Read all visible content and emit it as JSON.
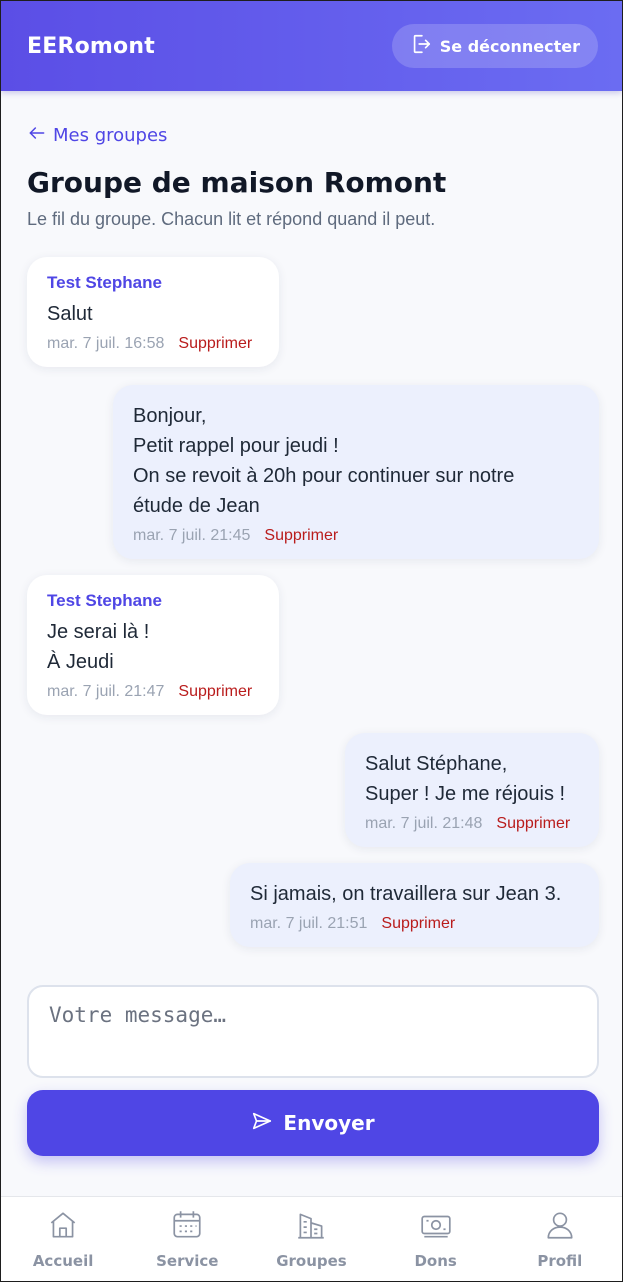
{
  "header": {
    "brand": "EERomont",
    "logout_label": "Se déconnecter"
  },
  "nav_back": {
    "label": "Mes groupes"
  },
  "page": {
    "title": "Groupe de maison Romont",
    "subtitle": "Le fil du groupe. Chacun lit et répond quand il peut."
  },
  "messages": [
    {
      "author": "Test Stephane",
      "text": "Salut",
      "time": "mar. 7 juil. 16:58",
      "delete_label": "Supprimer"
    },
    {
      "author": "",
      "text": "Bonjour,\nPetit rappel pour jeudi !\nOn se revoit à 20h pour continuer sur notre\nétude de Jean",
      "time": "mar. 7 juil. 21:45",
      "delete_label": "Supprimer"
    },
    {
      "author": "Test Stephane",
      "text": "Je serai là !\nÀ Jeudi",
      "time": "mar. 7 juil. 21:47",
      "delete_label": "Supprimer"
    },
    {
      "author": "",
      "text": "Salut Stéphane,\nSuper ! Je me réjouis !",
      "time": "mar. 7 juil. 21:48",
      "delete_label": "Supprimer"
    },
    {
      "author": "",
      "text": "Si jamais, on travaillera sur Jean 3.",
      "time": "mar. 7 juil. 21:51",
      "delete_label": "Supprimer"
    }
  ],
  "composer": {
    "placeholder": "Votre message…",
    "value": ""
  },
  "send_button": {
    "label": "Envoyer"
  },
  "bottom_nav": [
    {
      "label": "Accueil",
      "icon": "home-icon"
    },
    {
      "label": "Service",
      "icon": "calendar-icon"
    },
    {
      "label": "Groupes",
      "icon": "building-icon"
    },
    {
      "label": "Dons",
      "icon": "banknote-icon"
    },
    {
      "label": "Profil",
      "icon": "user-icon"
    }
  ],
  "colors": {
    "primary": "#4f46e5",
    "header_gradient_start": "#5b4ee6",
    "header_gradient_end": "#6b6cf2",
    "delete": "#b91c1c",
    "outgoing_bubble": "#ecf0fd",
    "background": "#f8f9fc"
  }
}
